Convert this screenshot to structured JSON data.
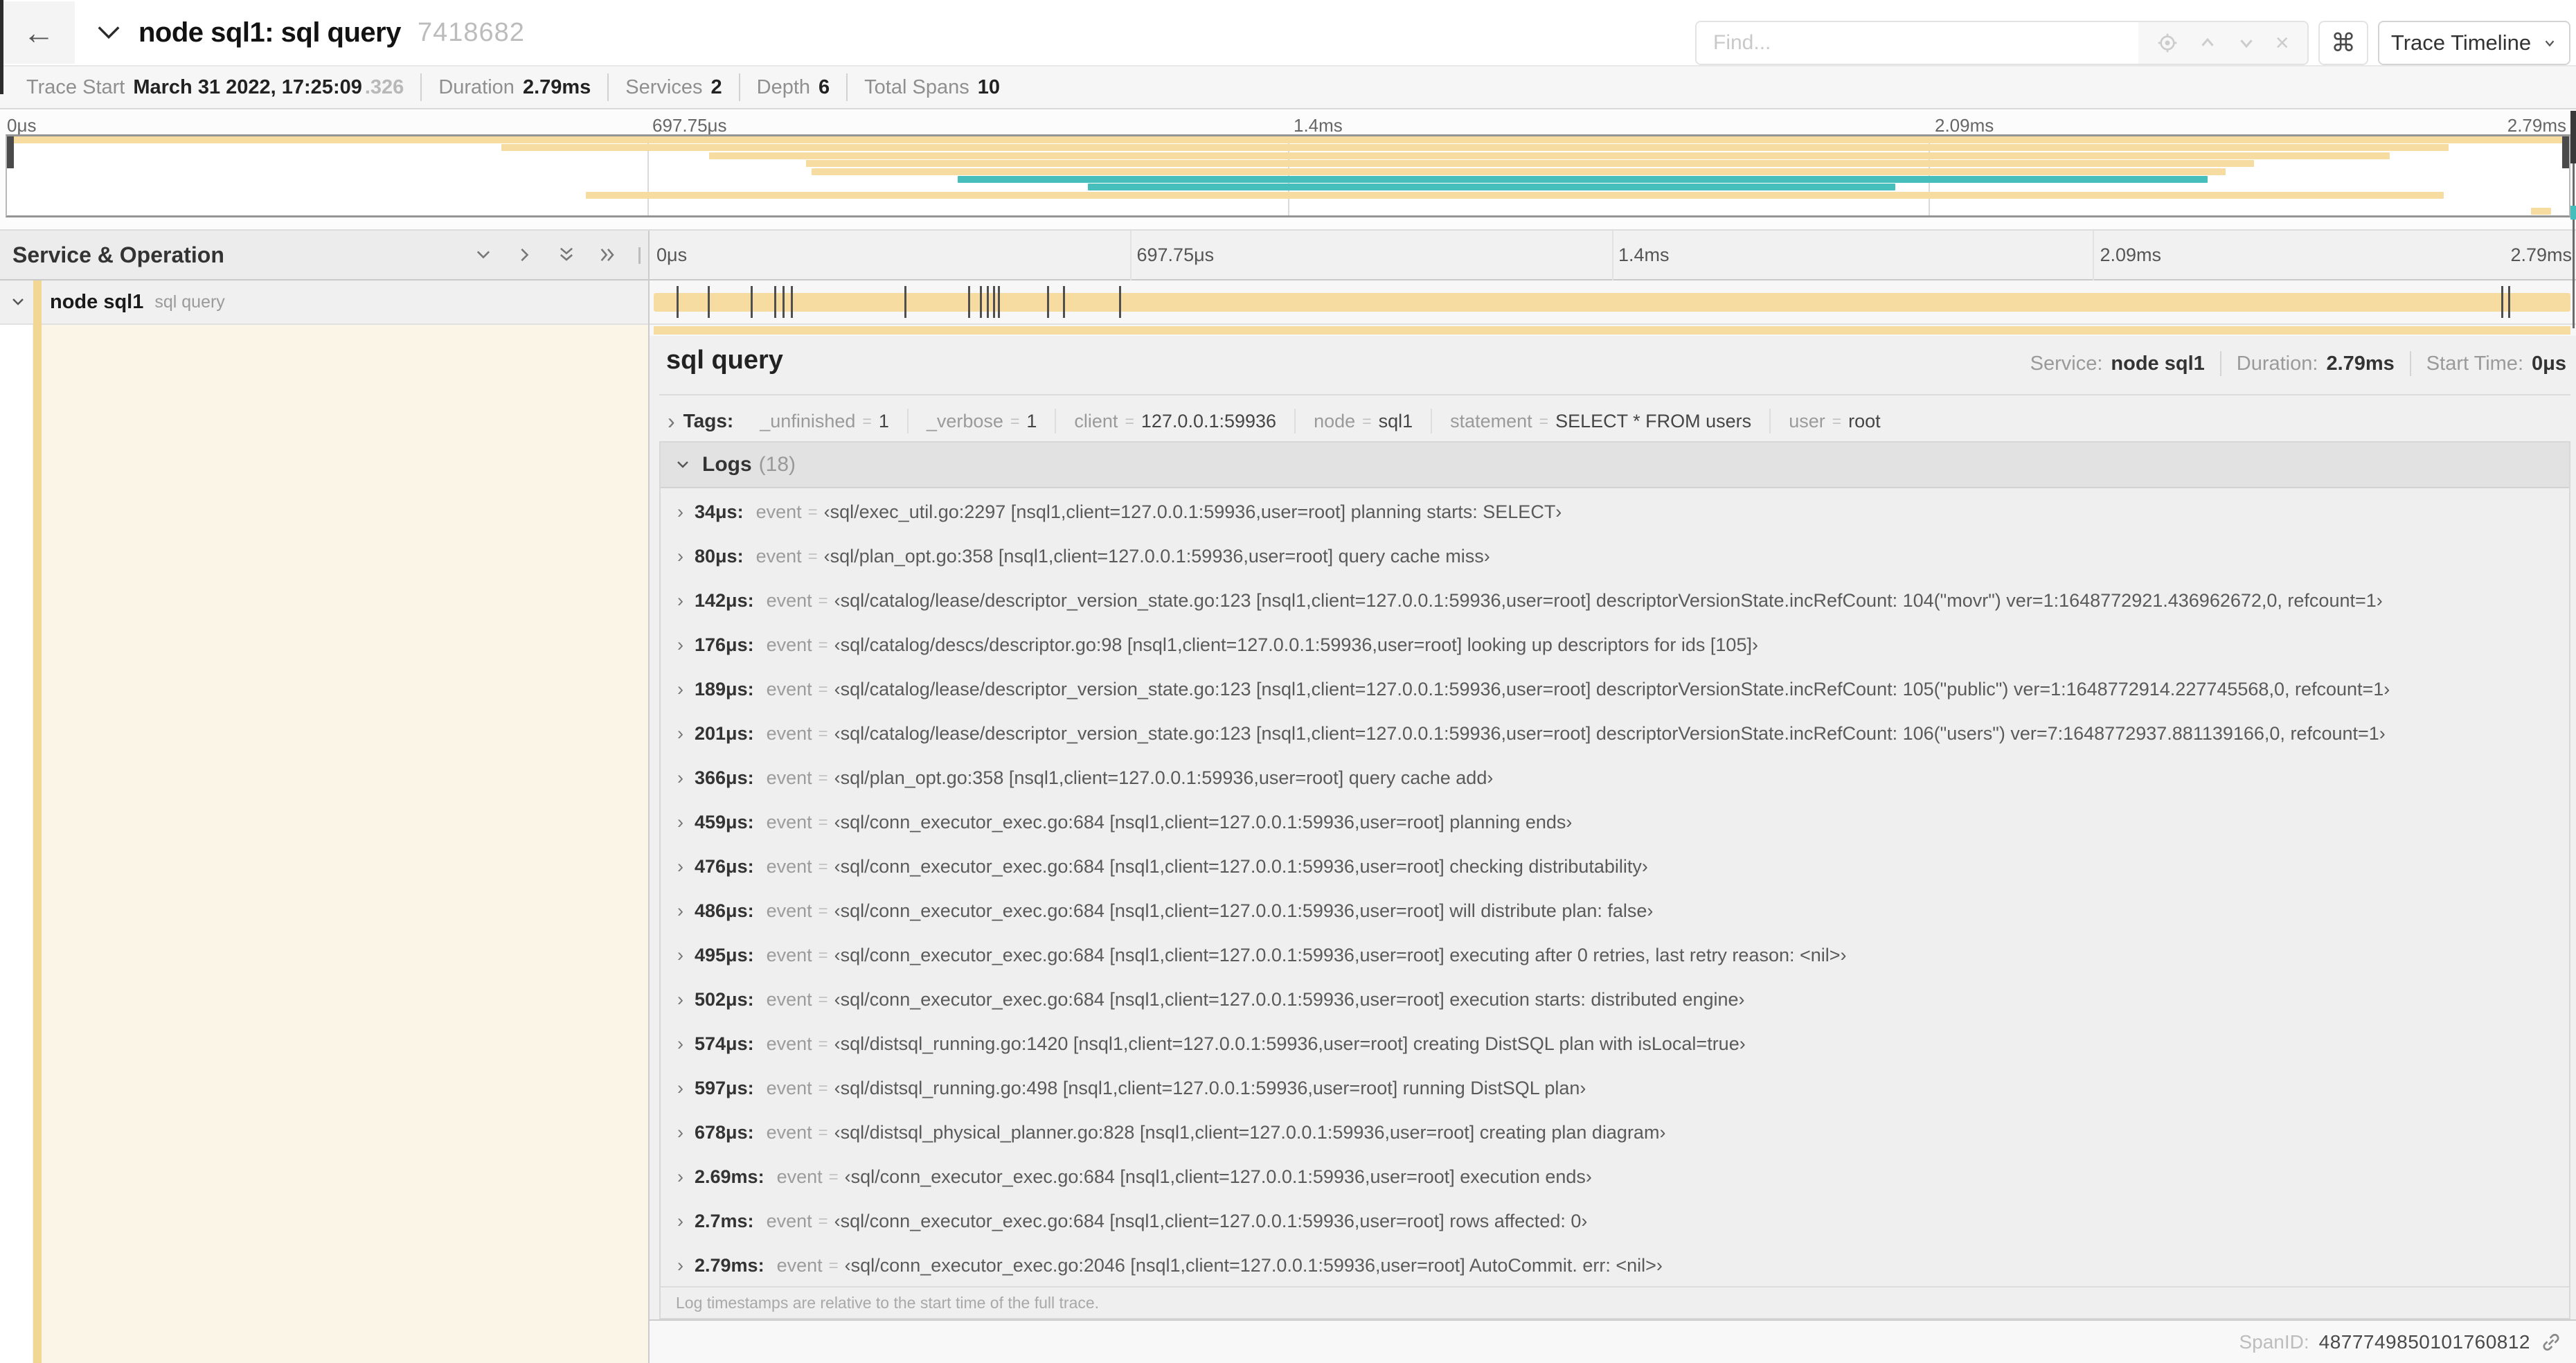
{
  "colors": {
    "tan": "#F6DCA0",
    "teal": "#45BEBC",
    "cream": "#FBF5E8",
    "strip": "#F2D694",
    "marker": "#4F4F4F"
  },
  "icons": {
    "back_arrow": "←",
    "command": "⌘",
    "close": "×",
    "expander": "›"
  },
  "header": {
    "title": "node sql1: sql query",
    "trace_id": "7418682",
    "find_placeholder": "Find...",
    "view_select_label": "Trace Timeline"
  },
  "summary": {
    "items": [
      {
        "label": "Trace Start",
        "value": "March 31 2022, 17:25:09",
        "extra": ".326"
      },
      {
        "label": "Duration",
        "value": "2.79ms"
      },
      {
        "label": "Services",
        "value": "2"
      },
      {
        "label": "Depth",
        "value": "6"
      },
      {
        "label": "Total Spans",
        "value": "10"
      }
    ]
  },
  "minimap": {
    "ticks": [
      "0μs",
      "697.75μs",
      "1.4ms",
      "2.09ms",
      "2.79ms"
    ],
    "rows": [
      {
        "start": 0.0,
        "end": 1.0,
        "color": "tan"
      },
      {
        "start": 0.193,
        "end": 0.953,
        "color": "tan"
      },
      {
        "start": 0.274,
        "end": 0.93,
        "color": "tan"
      },
      {
        "start": 0.312,
        "end": 0.877,
        "color": "tan"
      },
      {
        "start": 0.314,
        "end": 0.866,
        "color": "tan"
      },
      {
        "start": 0.371,
        "end": 0.859,
        "color": "teal"
      },
      {
        "start": 0.422,
        "end": 0.737,
        "color": "teal"
      },
      {
        "start": 0.226,
        "end": 0.951,
        "color": "tan"
      },
      {
        "start": 0.0,
        "end": 0.0,
        "color": "tan"
      },
      {
        "start": 0.985,
        "end": 0.993,
        "color": "tan"
      }
    ]
  },
  "timeline": {
    "left_header": "Service & Operation",
    "ticks": [
      "0μs",
      "697.75μs",
      "1.4ms",
      "2.09ms",
      "2.79ms"
    ],
    "row": {
      "service": "node sql1",
      "operation": "sql query"
    },
    "marker_fractions": [
      0.0122,
      0.0287,
      0.0509,
      0.0631,
      0.0677,
      0.072,
      0.1312,
      0.1645,
      0.1706,
      0.1742,
      0.1774,
      0.1799,
      0.2057,
      0.214,
      0.243,
      0.9642,
      0.9677
    ]
  },
  "detail": {
    "title": "sql query",
    "meta": [
      {
        "label": "Service:",
        "value": "node sql1"
      },
      {
        "label": "Duration:",
        "value": "2.79ms"
      },
      {
        "label": "Start Time:",
        "value": "0μs"
      }
    ],
    "tags_label": "Tags:",
    "tags": [
      {
        "key": "_unfinished",
        "value": "1"
      },
      {
        "key": "_verbose",
        "value": "1"
      },
      {
        "key": "client",
        "value": "127.0.0.1:59936"
      },
      {
        "key": "node",
        "value": "sql1"
      },
      {
        "key": "statement",
        "value": "SELECT * FROM users"
      },
      {
        "key": "user",
        "value": "root"
      }
    ],
    "logs_label": "Logs",
    "logs_count": "(18)",
    "log_key": "event",
    "logs": [
      {
        "time": "34μs:",
        "value": "‹sql/exec_util.go:2297 [nsql1,client=127.0.0.1:59936,user=root] planning starts: SELECT›"
      },
      {
        "time": "80μs:",
        "value": "‹sql/plan_opt.go:358 [nsql1,client=127.0.0.1:59936,user=root] query cache miss›"
      },
      {
        "time": "142μs:",
        "value": "‹sql/catalog/lease/descriptor_version_state.go:123 [nsql1,client=127.0.0.1:59936,user=root] descriptorVersionState.incRefCount: 104(\"movr\") ver=1:1648772921.436962672,0, refcount=1›"
      },
      {
        "time": "176μs:",
        "value": "‹sql/catalog/descs/descriptor.go:98 [nsql1,client=127.0.0.1:59936,user=root] looking up descriptors for ids [105]›"
      },
      {
        "time": "189μs:",
        "value": "‹sql/catalog/lease/descriptor_version_state.go:123 [nsql1,client=127.0.0.1:59936,user=root] descriptorVersionState.incRefCount: 105(\"public\") ver=1:1648772914.227745568,0, refcount=1›"
      },
      {
        "time": "201μs:",
        "value": "‹sql/catalog/lease/descriptor_version_state.go:123 [nsql1,client=127.0.0.1:59936,user=root] descriptorVersionState.incRefCount: 106(\"users\") ver=7:1648772937.881139166,0, refcount=1›"
      },
      {
        "time": "366μs:",
        "value": "‹sql/plan_opt.go:358 [nsql1,client=127.0.0.1:59936,user=root] query cache add›"
      },
      {
        "time": "459μs:",
        "value": "‹sql/conn_executor_exec.go:684 [nsql1,client=127.0.0.1:59936,user=root] planning ends›"
      },
      {
        "time": "476μs:",
        "value": "‹sql/conn_executor_exec.go:684 [nsql1,client=127.0.0.1:59936,user=root] checking distributability›"
      },
      {
        "time": "486μs:",
        "value": "‹sql/conn_executor_exec.go:684 [nsql1,client=127.0.0.1:59936,user=root] will distribute plan: false›"
      },
      {
        "time": "495μs:",
        "value": "‹sql/conn_executor_exec.go:684 [nsql1,client=127.0.0.1:59936,user=root] executing after 0 retries, last retry reason: <nil>›"
      },
      {
        "time": "502μs:",
        "value": "‹sql/conn_executor_exec.go:684 [nsql1,client=127.0.0.1:59936,user=root] execution starts: distributed engine›"
      },
      {
        "time": "574μs:",
        "value": "‹sql/distsql_running.go:1420 [nsql1,client=127.0.0.1:59936,user=root] creating DistSQL plan with isLocal=true›"
      },
      {
        "time": "597μs:",
        "value": "‹sql/distsql_running.go:498 [nsql1,client=127.0.0.1:59936,user=root] running DistSQL plan›"
      },
      {
        "time": "678μs:",
        "value": "‹sql/distsql_physical_planner.go:828 [nsql1,client=127.0.0.1:59936,user=root] creating plan diagram›"
      },
      {
        "time": "2.69ms:",
        "value": "‹sql/conn_executor_exec.go:684 [nsql1,client=127.0.0.1:59936,user=root] execution ends›"
      },
      {
        "time": "2.7ms:",
        "value": "‹sql/conn_executor_exec.go:684 [nsql1,client=127.0.0.1:59936,user=root] rows affected: 0›"
      },
      {
        "time": "2.79ms:",
        "value": "‹sql/conn_executor_exec.go:2046 [nsql1,client=127.0.0.1:59936,user=root] AutoCommit. err: <nil>›"
      }
    ],
    "note": "Log timestamps are relative to the start time of the full trace.",
    "spanid_label": "SpanID:",
    "spanid_value": "4877749850101760812"
  }
}
